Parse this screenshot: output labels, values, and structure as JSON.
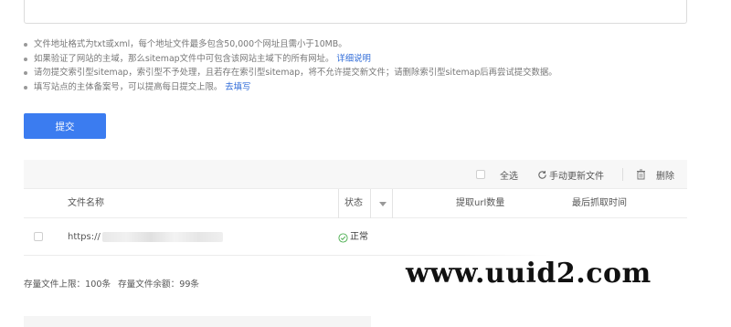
{
  "tips": [
    {
      "text": "文件地址格式为txt或xml，每个地址文件最多包含50,000个网址且需小于10MB。",
      "link": ""
    },
    {
      "text": "如果验证了网站的主域，那么sitemap文件中可包含该网站主域下的所有网址。",
      "link": "详细说明"
    },
    {
      "text": "请勿提交索引型sitemap，索引型不予处理，且若存在索引型sitemap，将不允许提交新文件；请删除索引型sitemap后再尝试提交数据。",
      "link": ""
    },
    {
      "text": "填写站点的主体备案号，可以提高每日提交上限。",
      "link": "去填写"
    }
  ],
  "submit_label": "提交",
  "toolbar": {
    "select_all": "全选",
    "manual_update": "手动更新文件",
    "delete": "删除"
  },
  "table": {
    "columns": {
      "file_name": "文件名称",
      "status": "状态",
      "url_count": "提取url数量",
      "last_crawl": "最后抓取时间"
    },
    "rows": [
      {
        "url_prefix": "https://",
        "status": "正常"
      }
    ]
  },
  "quota": {
    "limit": "存量文件上限：100条",
    "remaining": "存量文件余额：99条"
  },
  "watermark": "www.uuid2.com",
  "colors": {
    "accent": "#3b7cf0",
    "link": "#2f6bd8",
    "ok": "#4caf50"
  }
}
